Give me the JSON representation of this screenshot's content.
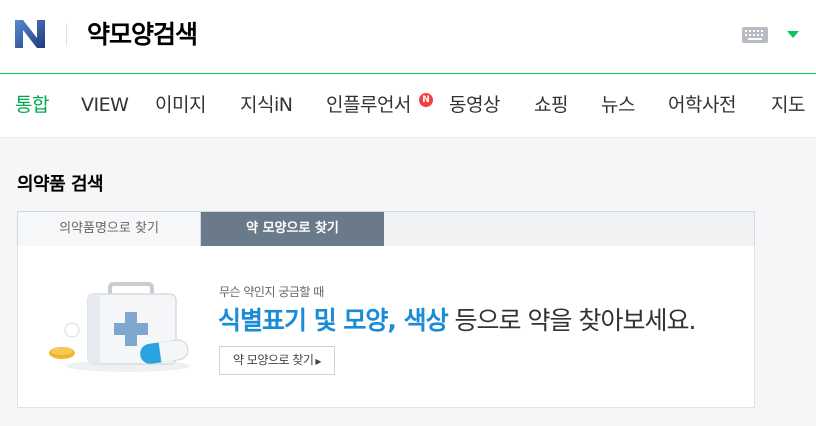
{
  "header": {
    "title": "약모양검색",
    "logo_letter": "N",
    "keyboard_icon": "keyboard-icon",
    "menu_icon": "caret-down-icon",
    "brand_color": "#03c75a"
  },
  "nav": {
    "tabs": [
      {
        "label": "통합",
        "active": true
      },
      {
        "label": "VIEW"
      },
      {
        "label": "이미지"
      },
      {
        "label": "지식iN"
      },
      {
        "label": "인플루언서"
      },
      {
        "label": "동영상"
      },
      {
        "label": "쇼핑"
      },
      {
        "label": "뉴스"
      },
      {
        "label": "어학사전"
      },
      {
        "label": "지도"
      }
    ],
    "new_badge": "N"
  },
  "main": {
    "section_title": "의약품 검색",
    "tabs": [
      {
        "label": "의약품명으로 찾기"
      },
      {
        "label": "약 모양으로 찾기",
        "active": true
      }
    ],
    "panel": {
      "sub_text": "무슨 약인지 궁금할 때",
      "headline_highlight": "식별표기 및 모양, 색상",
      "headline_rest": " 등으로 약을 찾아보세요.",
      "button_label": "약 모양으로 찾기",
      "illustration": "medicine-kit-icon"
    }
  }
}
